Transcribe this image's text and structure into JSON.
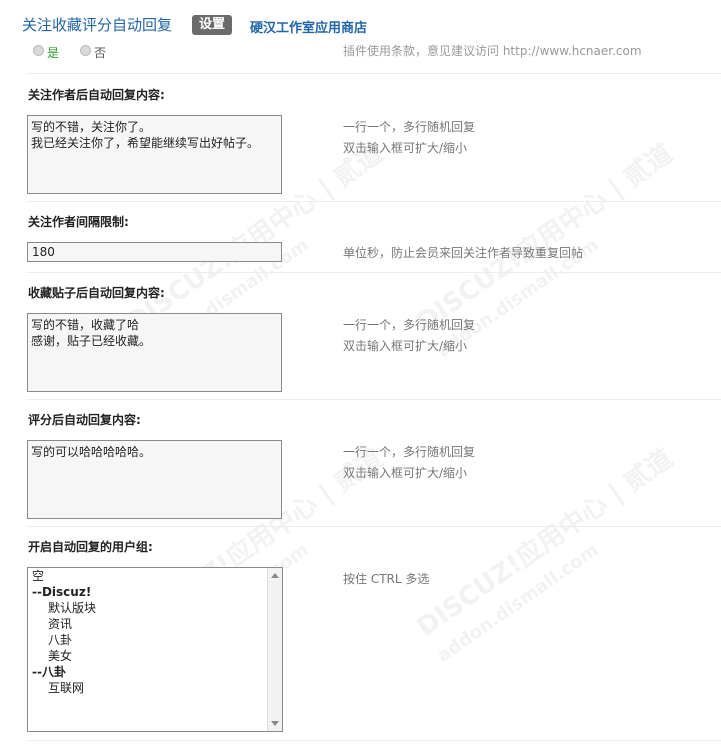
{
  "header": {
    "title": "关注收藏评分自动回复",
    "settings_label": "设置",
    "store_label": "硬汉工作室应用商店"
  },
  "top_partial": {
    "yes": "是",
    "no": "否",
    "tip": "插件使用条款，意见建议访问 http://www.hcnaer.com"
  },
  "follow_reply": {
    "label": "关注作者后自动回复内容:",
    "value": "写的不错，关注你了。\n我已经关注你了，希望能继续写出好帖子。",
    "tip1": "一行一个，多行随机回复",
    "tip2": "双击输入框可扩大/缩小"
  },
  "follow_interval": {
    "label": "关注作者间隔限制:",
    "value": "180",
    "tip": "单位秒，防止会员来回关注作者导致重复回帖"
  },
  "fav_reply": {
    "label": "收藏贴子后自动回复内容:",
    "value": "写的不错，收藏了哈\n感谢，贴子已经收藏。",
    "tip1": "一行一个，多行随机回复",
    "tip2": "双击输入框可扩大/缩小"
  },
  "rate_reply": {
    "label": "评分后自动回复内容:",
    "value": "写的可以哈哈哈哈哈。",
    "tip1": "一行一个，多行随机回复",
    "tip2": "双击输入框可扩大/缩小"
  },
  "usergroups": {
    "label": "开启自动回复的用户组:",
    "tip": "按住 CTRL 多选",
    "options": [
      "空",
      "--Discuz!",
      "默认版块",
      "资讯",
      "八卦",
      "美女",
      "--八卦",
      "互联网"
    ]
  },
  "watermark": {
    "text": "DISCUZ!应用中心 | 贰道",
    "sub": "addon.dismall.com"
  }
}
